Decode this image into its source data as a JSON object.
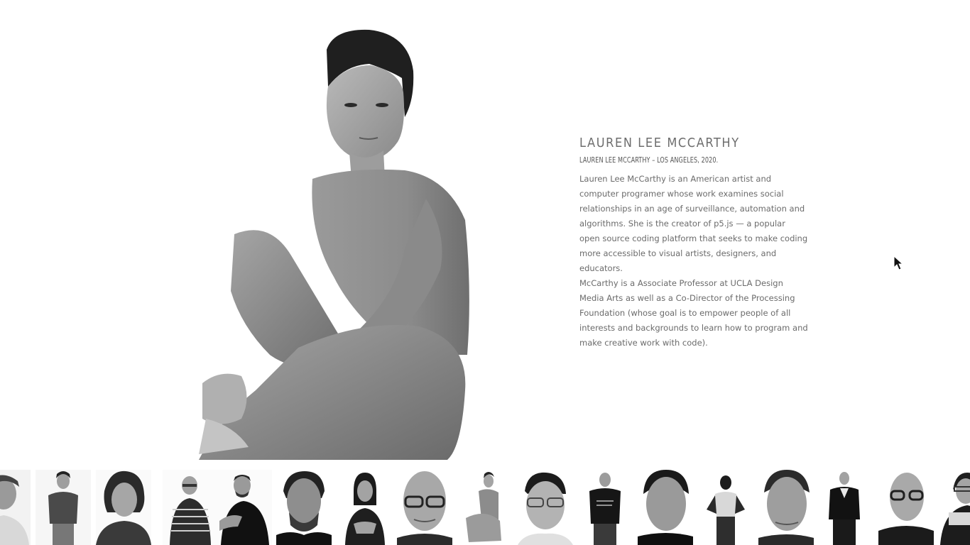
{
  "profile": {
    "name": "LAUREN LEE MCCARTHY",
    "caption": "LAUREN LEE MCCARTHY – LOS ANGELES, 2020.",
    "bio_paragraph_1": "Lauren Lee McCarthy is an American artist and computer programer whose work examines social relationships in an age of surveillance, automation and algorithms. She is the creator of p5.js — a popular open source coding platform that seeks to make coding more accessible to visual artists, designers, and educators.",
    "bio_paragraph_2": "McCarthy is a Associate Professor at UCLA Design Media Arts as well as a Co-Director of the Processing Foundation (whose goal is to empower people of all interests and backgrounds to learn how to program and make creative work with code).",
    "photo_icon": "portrait-photo-bw"
  },
  "thumbnails": [
    {
      "id": "thumb-1",
      "icon": "portrait-man-partial"
    },
    {
      "id": "thumb-2",
      "icon": "portrait-woman-standing"
    },
    {
      "id": "thumb-3",
      "icon": "portrait-woman-closeup"
    },
    {
      "id": "thumb-4",
      "icon": "portrait-man-glasses-striped"
    },
    {
      "id": "thumb-5",
      "icon": "portrait-man-bearded-sitting"
    },
    {
      "id": "thumb-6",
      "icon": "portrait-man-bearded-closeup"
    },
    {
      "id": "thumb-7",
      "icon": "portrait-woman-sitting"
    },
    {
      "id": "thumb-8",
      "icon": "portrait-elderly-man-glasses"
    },
    {
      "id": "thumb-9",
      "icon": "portrait-woman-sitting-small"
    },
    {
      "id": "thumb-10",
      "icon": "portrait-man-glasses-closeup"
    },
    {
      "id": "thumb-11",
      "icon": "portrait-man-tshirt"
    },
    {
      "id": "thumb-12",
      "icon": "portrait-man-closeup"
    },
    {
      "id": "thumb-13",
      "icon": "portrait-woman-standing-hands-hips"
    },
    {
      "id": "thumb-14",
      "icon": "portrait-man-older-closeup"
    },
    {
      "id": "thumb-15",
      "icon": "portrait-man-suit"
    },
    {
      "id": "thumb-16",
      "icon": "portrait-bald-man-glasses"
    },
    {
      "id": "thumb-17",
      "icon": "portrait-woman-open-shirt-partial"
    }
  ],
  "colors": {
    "background": "#ffffff",
    "text": "#6b6b6b",
    "heading": "#6d6d6d"
  }
}
